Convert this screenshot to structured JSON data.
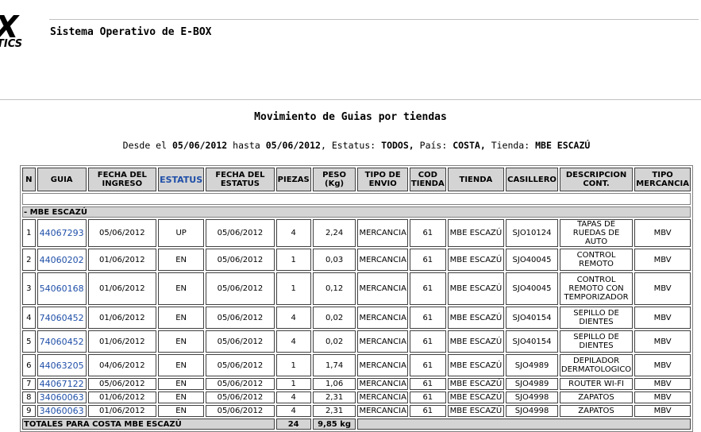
{
  "logo": {
    "big": "X",
    "small": "TICS"
  },
  "system_title": "Sistema Operativo de E-BOX",
  "report_title": "Movimiento de Guias por tiendas",
  "filters": {
    "desde_label": "Desde el",
    "desde": "05/06/2012",
    "hasta_label": "hasta",
    "hasta": "05/06/2012",
    "estatus_label": ", Estatus:",
    "estatus": "TODOS,",
    "pais_label": "País:",
    "pais": "COSTA,",
    "tienda_label": "Tienda:",
    "tienda": "MBE ESCAZÚ"
  },
  "table": {
    "headers": [
      "N",
      "GUIA",
      "FECHA DEL INGRESO",
      "ESTATUS",
      "FECHA DEL ESTATUS",
      "PIEZAS",
      "PESO (Kg)",
      "TIPO DE ENVIO",
      "COD TIENDA",
      "TIENDA",
      "CASILLERO",
      "DESCRIPCION CONT.",
      "TIPO MERCANCIA"
    ],
    "group_label": "- MBE ESCAZÚ",
    "rows": [
      {
        "n": "1",
        "guia": "44067293",
        "fecha_ingreso": "05/06/2012",
        "estatus": "UP",
        "fecha_estatus": "05/06/2012",
        "piezas": "4",
        "peso": "2,24",
        "tipo_envio": "MERCANCIA",
        "cod_tienda": "61",
        "tienda": "MBE ESCAZÚ",
        "casillero": "SJO10124",
        "descripcion": "TAPAS DE RUEDAS DE AUTO",
        "tipo_mercancia": "MBV"
      },
      {
        "n": "2",
        "guia": "44060202",
        "fecha_ingreso": "01/06/2012",
        "estatus": "EN",
        "fecha_estatus": "05/06/2012",
        "piezas": "1",
        "peso": "0,03",
        "tipo_envio": "MERCANCIA",
        "cod_tienda": "61",
        "tienda": "MBE ESCAZÚ",
        "casillero": "SJO40045",
        "descripcion": "CONTROL REMOTO",
        "tipo_mercancia": "MBV"
      },
      {
        "n": "3",
        "guia": "54060168",
        "fecha_ingreso": "01/06/2012",
        "estatus": "EN",
        "fecha_estatus": "05/06/2012",
        "piezas": "1",
        "peso": "0,12",
        "tipo_envio": "MERCANCIA",
        "cod_tienda": "61",
        "tienda": "MBE ESCAZÚ",
        "casillero": "SJO40045",
        "descripcion": "CONTROL REMOTO CON TEMPORIZADOR",
        "tipo_mercancia": "MBV"
      },
      {
        "n": "4",
        "guia": "74060452",
        "fecha_ingreso": "01/06/2012",
        "estatus": "EN",
        "fecha_estatus": "05/06/2012",
        "piezas": "4",
        "peso": "0,02",
        "tipo_envio": "MERCANCIA",
        "cod_tienda": "61",
        "tienda": "MBE ESCAZÚ",
        "casillero": "SJO40154",
        "descripcion": "SEPILLO DE DIENTES",
        "tipo_mercancia": "MBV"
      },
      {
        "n": "5",
        "guia": "74060452",
        "fecha_ingreso": "01/06/2012",
        "estatus": "EN",
        "fecha_estatus": "05/06/2012",
        "piezas": "4",
        "peso": "0,02",
        "tipo_envio": "MERCANCIA",
        "cod_tienda": "61",
        "tienda": "MBE ESCAZÚ",
        "casillero": "SJO40154",
        "descripcion": "SEPILLO DE DIENTES",
        "tipo_mercancia": "MBV"
      },
      {
        "n": "6",
        "guia": "44063205",
        "fecha_ingreso": "04/06/2012",
        "estatus": "EN",
        "fecha_estatus": "05/06/2012",
        "piezas": "1",
        "peso": "1,74",
        "tipo_envio": "MERCANCIA",
        "cod_tienda": "61",
        "tienda": "MBE ESCAZÚ",
        "casillero": "SJO4989",
        "descripcion": "DEPILADOR DERMATOLOGICO",
        "tipo_mercancia": "MBV"
      },
      {
        "n": "7",
        "guia": "44067122",
        "fecha_ingreso": "05/06/2012",
        "estatus": "EN",
        "fecha_estatus": "05/06/2012",
        "piezas": "1",
        "peso": "1,06",
        "tipo_envio": "MERCANCIA",
        "cod_tienda": "61",
        "tienda": "MBE ESCAZÚ",
        "casillero": "SJO4989",
        "descripcion": "ROUTER WI-FI",
        "tipo_mercancia": "MBV"
      },
      {
        "n": "8",
        "guia": "34060063",
        "fecha_ingreso": "01/06/2012",
        "estatus": "EN",
        "fecha_estatus": "05/06/2012",
        "piezas": "4",
        "peso": "2,31",
        "tipo_envio": "MERCANCIA",
        "cod_tienda": "61",
        "tienda": "MBE ESCAZÚ",
        "casillero": "SJO4998",
        "descripcion": "ZAPATOS",
        "tipo_mercancia": "MBV"
      },
      {
        "n": "9",
        "guia": "34060063",
        "fecha_ingreso": "01/06/2012",
        "estatus": "EN",
        "fecha_estatus": "05/06/2012",
        "piezas": "4",
        "peso": "2,31",
        "tipo_envio": "MERCANCIA",
        "cod_tienda": "61",
        "tienda": "MBE ESCAZÚ",
        "casillero": "SJO4998",
        "descripcion": "ZAPATOS",
        "tipo_mercancia": "MBV"
      }
    ],
    "totals": {
      "label": "TOTALES PARA COSTA MBE ESCAZÚ",
      "piezas": "24",
      "peso": "9,85 kg"
    }
  },
  "colors": {
    "link": "#1f4fa8",
    "header_bg": "#d4d4d4"
  }
}
